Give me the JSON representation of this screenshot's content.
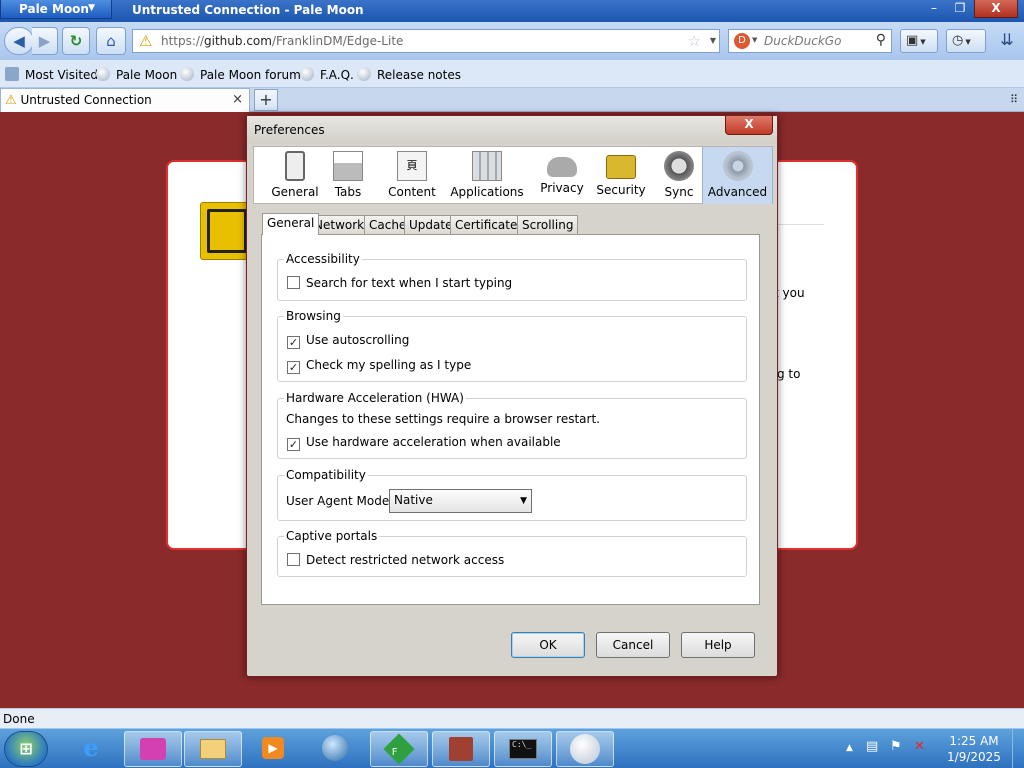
{
  "window": {
    "app_menu_label": "Pale Moon",
    "title": "Untrusted Connection - Pale Moon",
    "minimize_glyph": "–",
    "maximize_glyph": "❐",
    "close_glyph": "X"
  },
  "navbar": {
    "url_prefix": "https://",
    "url_domain": "github.com",
    "url_path": "/FranklinDM/Edge-Lite",
    "search_placeholder": "DuckDuckGo",
    "icons": [
      "back-icon",
      "forward-icon",
      "reload-icon",
      "home-icon",
      "warning-icon",
      "star-icon",
      "duckduckgo-icon",
      "search-icon",
      "downloads-icon",
      "history-icon",
      "menu-icon"
    ]
  },
  "bookmarks": [
    "Most Visited",
    "Pale Moon",
    "Pale Moon forum",
    "F.A.Q.",
    "Release notes"
  ],
  "tabs": [
    {
      "label": "Untrusted Connection",
      "close": "×"
    }
  ],
  "new_tab_glyph": "+",
  "content": {
    "frag1": "t you",
    "frag2": "ing to"
  },
  "status": "Done",
  "dialog": {
    "title": "Preferences",
    "close_glyph": "X",
    "panes": [
      "General",
      "Tabs",
      "Content",
      "Applications",
      "Privacy",
      "Security",
      "Sync",
      "Advanced"
    ],
    "selected_pane": "Advanced",
    "subtabs": [
      "General",
      "Network",
      "Cache",
      "Update",
      "Certificates",
      "Scrolling"
    ],
    "selected_subtab": "General",
    "groups": {
      "accessibility": {
        "caption": "Accessibility",
        "search_text": {
          "label": "Search for text when I start typing",
          "checked": false
        }
      },
      "browsing": {
        "caption": "Browsing",
        "autoscroll": {
          "label": "Use autoscrolling",
          "checked": true
        },
        "spelling": {
          "label": "Check my spelling as I type",
          "checked": true
        }
      },
      "hwa": {
        "caption": "Hardware Acceleration (HWA)",
        "note": "Changes to these settings require a browser restart.",
        "use_hwa": {
          "label": "Use hardware acceleration when available",
          "checked": true
        }
      },
      "compat": {
        "caption": "Compatibility",
        "ua_label": "User Agent Mode:",
        "ua_value": "Native"
      },
      "captive": {
        "caption": "Captive portals",
        "detect": {
          "label": "Detect restricted network access",
          "checked": false
        }
      }
    },
    "buttons": {
      "ok": "OK",
      "cancel": "Cancel",
      "help": "Help"
    }
  },
  "taskbar": {
    "start_glyph": "⊞",
    "cmd_text": "C:\\_",
    "f_text": "F",
    "time": "1:25 AM",
    "date": "1/9/2025"
  },
  "check_glyph": "✓"
}
